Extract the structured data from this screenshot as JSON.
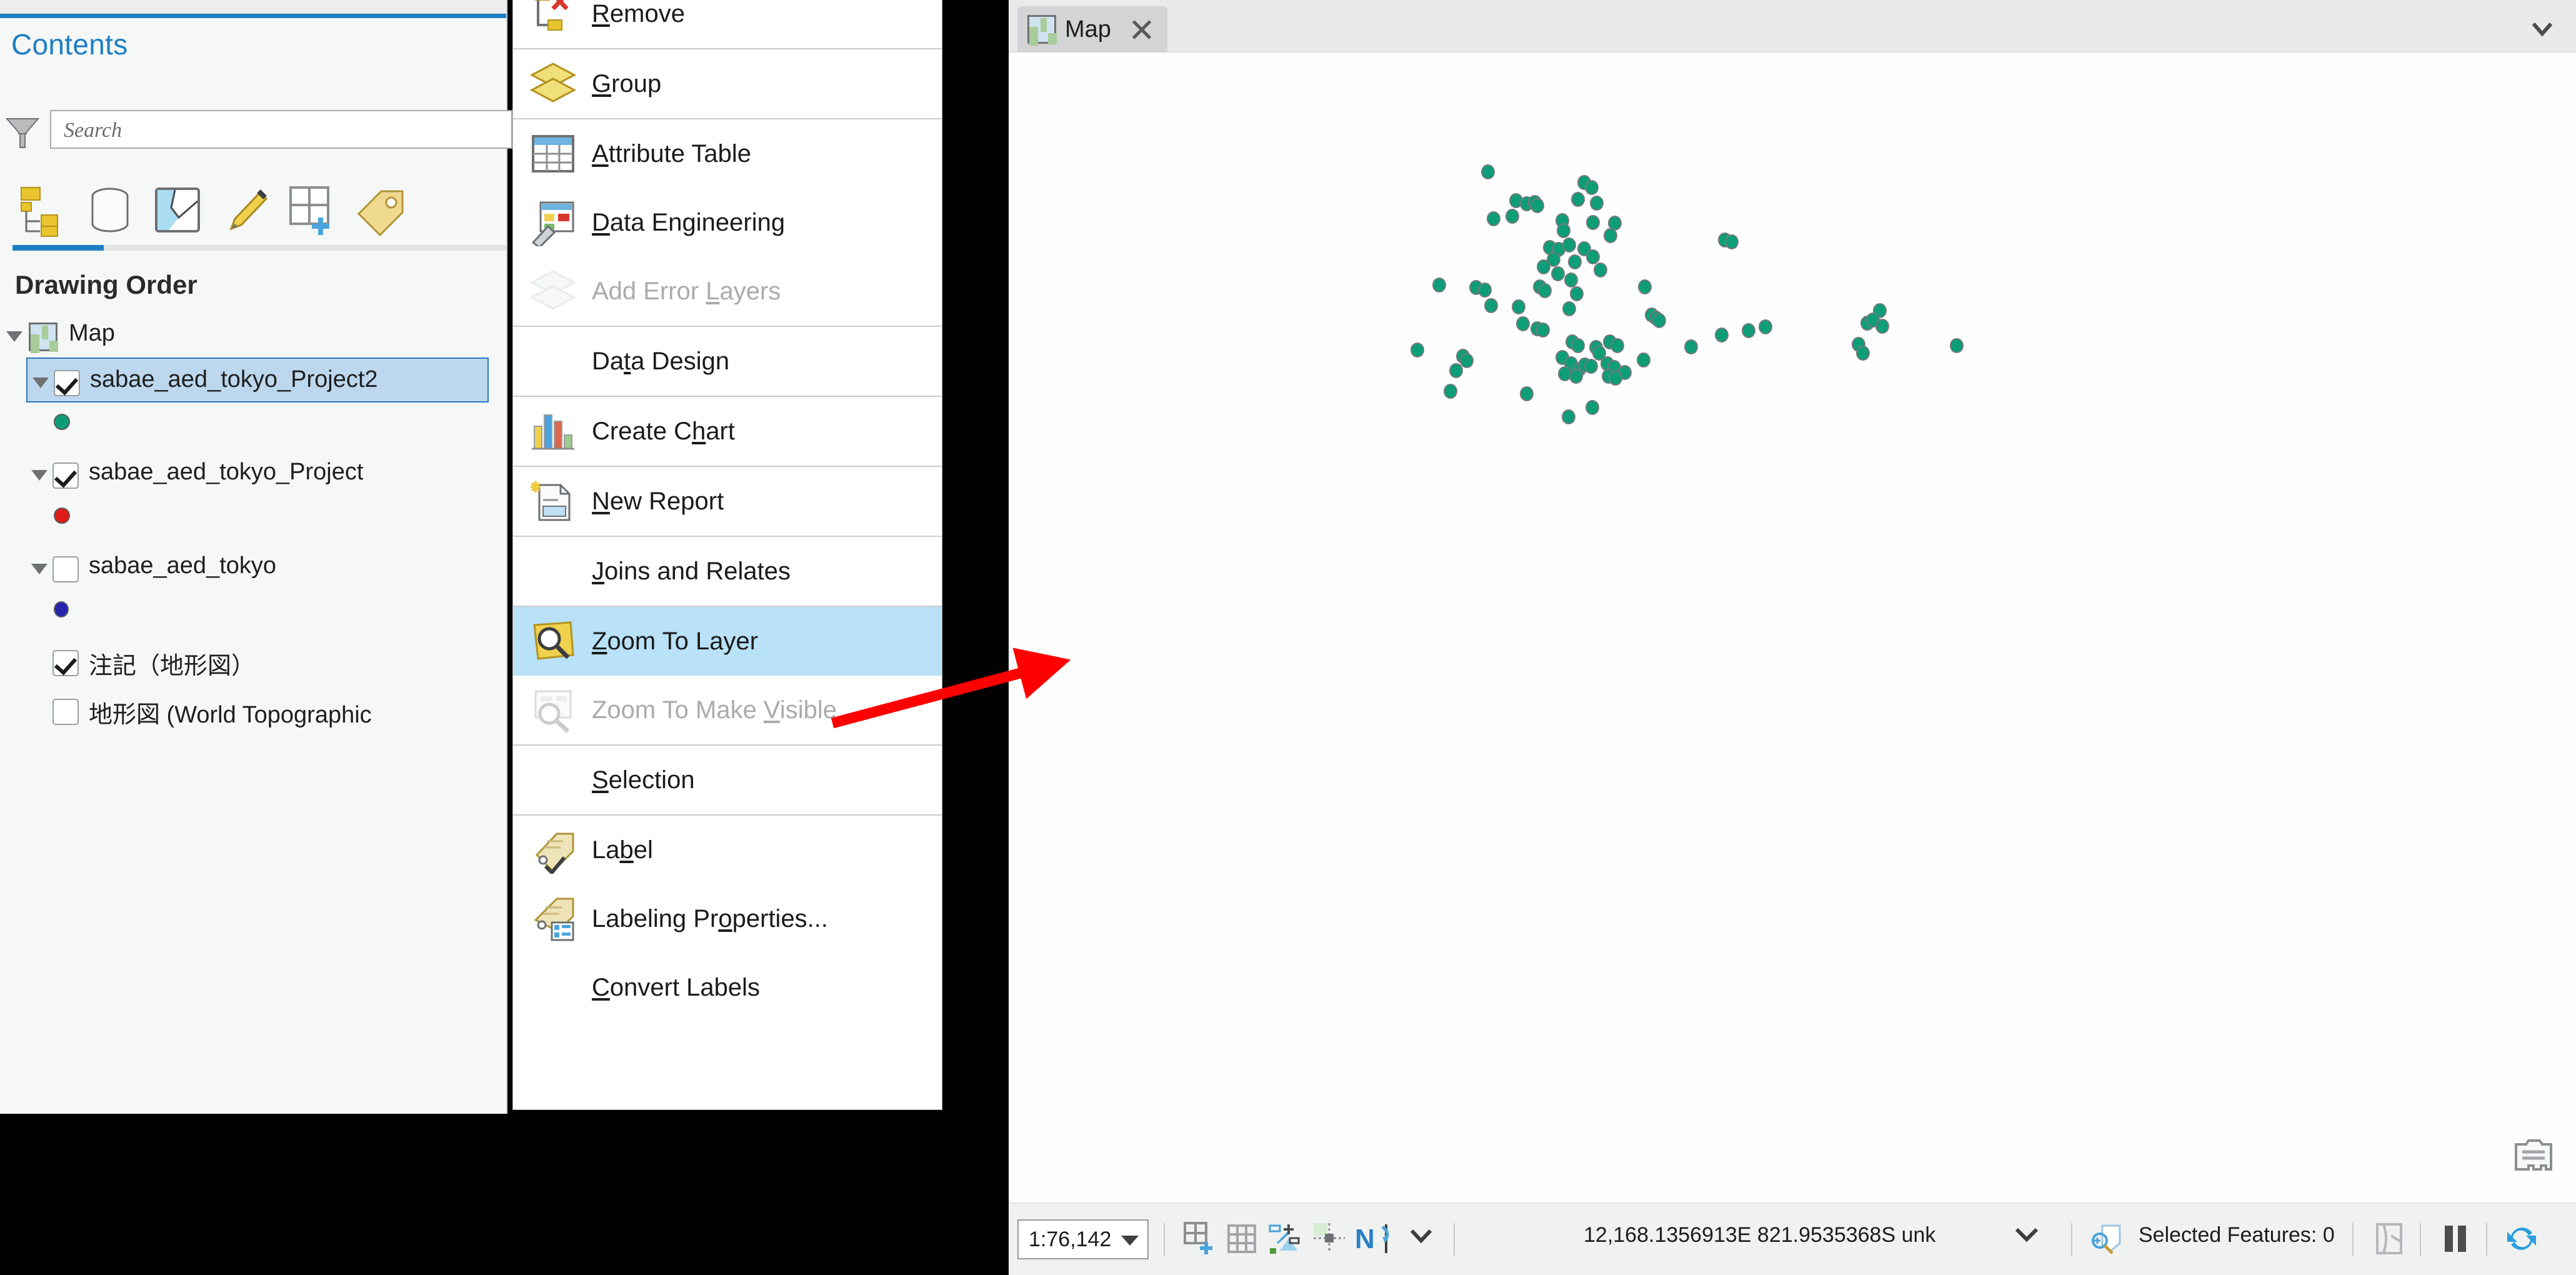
{
  "panel": {
    "title": "Contents",
    "search_placeholder": "Search",
    "drawing_order": "Drawing Order",
    "tabs": [
      {
        "name": "drawing-order-tab",
        "icon": "drawing-order-icon"
      },
      {
        "name": "data-source-tab",
        "icon": "data-source-icon"
      },
      {
        "name": "selection-tab",
        "icon": "selection-icon"
      },
      {
        "name": "editing-tab",
        "icon": "pencil-icon"
      },
      {
        "name": "fields-tab",
        "icon": "add-field-icon"
      },
      {
        "name": "labeling-tab",
        "icon": "label-tag-icon"
      }
    ],
    "tree": [
      {
        "label": "Map",
        "kind": "map",
        "indent": 0,
        "expander": "open",
        "checkbox": null
      },
      {
        "label": "sabae_aed_tokyo_Project2",
        "kind": "layer",
        "indent": 1,
        "expander": "open",
        "checkbox": "checked",
        "selected": true,
        "symbol_color": "#0d9e78"
      },
      {
        "label": "sabae_aed_tokyo_Project",
        "kind": "layer",
        "indent": 1,
        "expander": "open",
        "checkbox": "checked",
        "selected": false,
        "symbol_color": "#e01b18"
      },
      {
        "label": "sabae_aed_tokyo",
        "kind": "layer",
        "indent": 1,
        "expander": "open",
        "checkbox": "unchecked",
        "selected": false,
        "symbol_color": "#2626b0"
      },
      {
        "label": "注記（地形図）",
        "kind": "layer",
        "indent": 1,
        "expander": null,
        "checkbox": "checked",
        "selected": false,
        "symbol_color": null
      },
      {
        "label": "地形図 (World Topographic",
        "kind": "layer",
        "indent": 1,
        "expander": null,
        "checkbox": "unchecked",
        "selected": false,
        "symbol_color": null
      }
    ]
  },
  "context_menu": {
    "items": [
      {
        "label": "Remove",
        "mnemonic": "R",
        "icon": "remove-layer-icon",
        "disabled": false,
        "highlighted": false,
        "sep_after": true
      },
      {
        "label": "Group",
        "mnemonic": "G",
        "icon": "group-layers-icon",
        "disabled": false,
        "highlighted": false,
        "sep_after": true
      },
      {
        "label": "Attribute Table",
        "mnemonic": "A",
        "icon": "attribute-table-icon",
        "disabled": false,
        "highlighted": false,
        "sep_after": false
      },
      {
        "label": "Data Engineering",
        "mnemonic": "D",
        "icon": "data-engineering-icon",
        "disabled": false,
        "highlighted": false,
        "sep_after": false
      },
      {
        "label": "Add Error Layers",
        "mnemonic": "L",
        "icon": "add-error-layers-icon",
        "disabled": true,
        "highlighted": false,
        "sep_after": true
      },
      {
        "label": "Data Design",
        "mnemonic": "t",
        "icon": null,
        "disabled": false,
        "highlighted": false,
        "sep_after": true
      },
      {
        "label": "Create Chart",
        "mnemonic": "h",
        "icon": "create-chart-icon",
        "disabled": false,
        "highlighted": false,
        "sep_after": true
      },
      {
        "label": "New Report",
        "mnemonic": "N",
        "icon": "new-report-icon",
        "disabled": false,
        "highlighted": false,
        "sep_after": true
      },
      {
        "label": "Joins and Relates",
        "mnemonic": "J",
        "icon": null,
        "disabled": false,
        "highlighted": false,
        "sep_after": true
      },
      {
        "label": "Zoom To Layer",
        "mnemonic": "Z",
        "icon": "zoom-to-layer-icon",
        "disabled": false,
        "highlighted": true,
        "sep_after": false
      },
      {
        "label": "Zoom To Make Visible",
        "mnemonic": "V",
        "icon": "zoom-to-make-visible-icon",
        "disabled": true,
        "highlighted": false,
        "sep_after": true
      },
      {
        "label": "Selection",
        "mnemonic": "S",
        "icon": null,
        "disabled": false,
        "highlighted": false,
        "sep_after": true
      },
      {
        "label": "Label",
        "mnemonic": "b",
        "icon": "label-icon",
        "disabled": false,
        "highlighted": false,
        "sep_after": false
      },
      {
        "label": "Labeling Properties...",
        "mnemonic": "o",
        "icon": "labeling-properties-icon",
        "disabled": false,
        "highlighted": false,
        "sep_after": false
      },
      {
        "label": "Convert Labels",
        "mnemonic": "C",
        "icon": null,
        "disabled": false,
        "highlighted": false,
        "sep_after": false
      }
    ]
  },
  "map_view": {
    "tab_label": "Map",
    "tab_icon": "map-thumbnail-icon",
    "point_color": "#0d9e78",
    "point_outline": "#76797b"
  },
  "status_bar": {
    "scale": "1:76,142",
    "coordinates": "12,168.1356913E 821.9535368S unk",
    "selected_features": "Selected Features: 0",
    "icons": [
      "add-grid-icon",
      "grid-icon",
      "snapping-icon",
      "edit-vertex-icon",
      "north-flow-icon",
      "chevron-down-icon"
    ],
    "right_icons": [
      "selection-zoom-icon",
      "layout-icon",
      "pause-icon",
      "refresh-icon"
    ]
  },
  "chart_data": {
    "type": "scatter",
    "title": "",
    "xlabel": "",
    "ylabel": "",
    "series": [
      {
        "name": "sabae_aed_tokyo_Project2",
        "color": "#0d9e78",
        "points": [
          [
            767,
            190
          ],
          [
            921,
            207
          ],
          [
            933,
            215
          ],
          [
            941,
            240
          ],
          [
            812,
            236
          ],
          [
            829,
            241
          ],
          [
            842,
            239
          ],
          [
            846,
            244
          ],
          [
            911,
            234
          ],
          [
            806,
            261
          ],
          [
            776,
            265
          ],
          [
            886,
            268
          ],
          [
            935,
            271
          ],
          [
            970,
            272
          ],
          [
            888,
            284
          ],
          [
            963,
            292
          ],
          [
            1146,
            299
          ],
          [
            1157,
            302
          ],
          [
            866,
            311
          ],
          [
            880,
            314
          ],
          [
            897,
            307
          ],
          [
            921,
            313
          ],
          [
            872,
            330
          ],
          [
            906,
            334
          ],
          [
            935,
            326
          ],
          [
            856,
            342
          ],
          [
            947,
            347
          ],
          [
            879,
            353
          ],
          [
            900,
            363
          ],
          [
            1018,
            374
          ],
          [
            689,
            371
          ],
          [
            748,
            375
          ],
          [
            762,
            379
          ],
          [
            850,
            374
          ],
          [
            858,
            380
          ],
          [
            909,
            385
          ],
          [
            772,
            404
          ],
          [
            816,
            406
          ],
          [
            897,
            409
          ],
          [
            1394,
            412
          ],
          [
            1029,
            419
          ],
          [
            1036,
            424
          ],
          [
            1041,
            428
          ],
          [
            1374,
            432
          ],
          [
            1383,
            427
          ],
          [
            1398,
            437
          ],
          [
            1211,
            438
          ],
          [
            1184,
            444
          ],
          [
            1141,
            451
          ],
          [
            823,
            433
          ],
          [
            846,
            441
          ],
          [
            855,
            443
          ],
          [
            1360,
            466
          ],
          [
            1367,
            480
          ],
          [
            1517,
            468
          ],
          [
            1092,
            470
          ],
          [
            654,
            475
          ],
          [
            902,
            462
          ],
          [
            911,
            468
          ],
          [
            940,
            471
          ],
          [
            962,
            462
          ],
          [
            974,
            468
          ],
          [
            945,
            480
          ],
          [
            1016,
            491
          ],
          [
            886,
            487
          ],
          [
            900,
            497
          ],
          [
            913,
            506
          ],
          [
            922,
            499
          ],
          [
            932,
            501
          ],
          [
            958,
            497
          ],
          [
            969,
            503
          ],
          [
            986,
            511
          ],
          [
            727,
            485
          ],
          [
            733,
            492
          ],
          [
            716,
            508
          ],
          [
            890,
            513
          ],
          [
            908,
            517
          ],
          [
            960,
            517
          ],
          [
            971,
            520
          ],
          [
            707,
            541
          ],
          [
            829,
            545
          ],
          [
            934,
            567
          ],
          [
            896,
            582
          ]
        ]
      }
    ]
  }
}
